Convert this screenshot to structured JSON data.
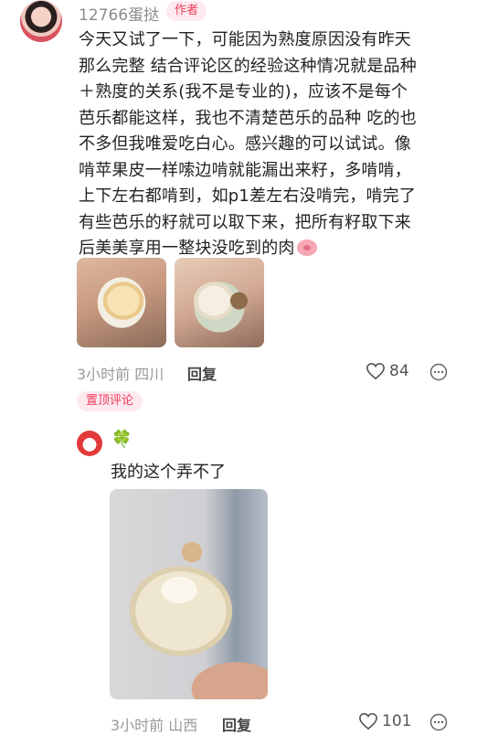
{
  "main_comment": {
    "username": "12766蛋挞",
    "author_tag": "作者",
    "lines": [
      "今天又试了一下，可能因为熟度原因没有昨天",
      "那么完整 结合评论区的经验这种情况就是品种",
      "＋熟度的关系(我不是专业的)，应该不是每个",
      "芭乐都能这样，我也不清楚芭乐的品种 吃的也",
      "不多但我唯爱吃白心。感兴趣的可以试试。像",
      "啃苹果皮一样嗦边啃就能漏出来籽，多啃啃，",
      "上下左右都啃到，如p1差左右没啃完，啃完了",
      "有些芭乐的籽就可以取下来，把所有籽取下来",
      "后美美享用一整块没吃到的肉"
    ],
    "emoji": "pig-face-emoji",
    "time": "3小时前",
    "location": "四川",
    "reply_label": "回复",
    "likes": "84",
    "pinned_tag": "置顶评论"
  },
  "reply_comment": {
    "emoji_name": "🍀",
    "text": "我的这个弄不了",
    "time": "3小时前",
    "location": "山西",
    "reply_label": "回复",
    "likes": "101"
  },
  "icons": {
    "heart": "heart-outline-icon",
    "more": "more-dots-icon"
  },
  "colors": {
    "accent": "#f03c5c",
    "tag_bg": "#fde9ee",
    "meta": "#999999"
  }
}
